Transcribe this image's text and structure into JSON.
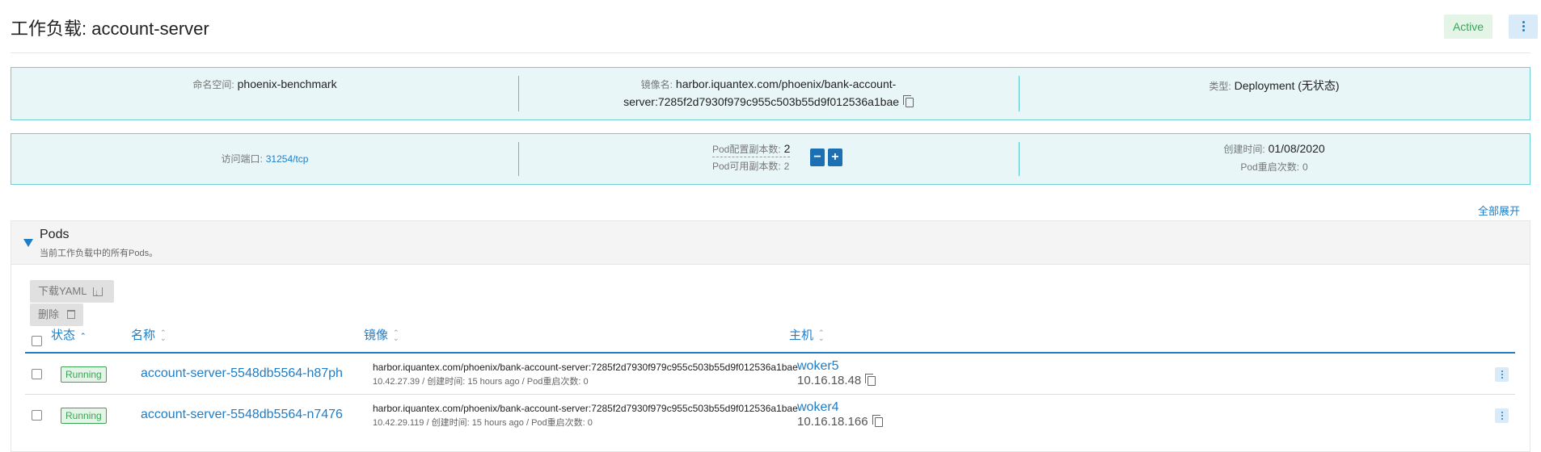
{
  "header": {
    "title": "工作负载: account-server",
    "status": "Active"
  },
  "info_top": {
    "namespace_label": "命名空间:",
    "namespace_value": "phoenix-benchmark",
    "image_label": "镜像名:",
    "image_value_line1": "harbor.iquantex.com/phoenix/bank-account-",
    "image_value_line2": "server:7285f2d7930f979c955c503b55d9f012536a1bae",
    "type_label": "类型:",
    "type_value": "Deployment (无状态)"
  },
  "info_bottom": {
    "port_label": "访问端口:",
    "port_value": "31254/tcp",
    "pod_config_label": "Pod配置副本数:",
    "pod_config_value": "2",
    "pod_available_label": "Pod可用副本数:",
    "pod_available_value": "2",
    "minus": "−",
    "plus": "+",
    "created_label": "创建时间:",
    "created_value": "01/08/2020",
    "restart_label": "Pod重启次数:",
    "restart_value": "0"
  },
  "expand_all": "全部展开",
  "pods": {
    "title": "Pods",
    "subtitle": "当前工作负载中的所有Pods。",
    "download_yaml": "下载YAML",
    "delete": "删除",
    "columns": [
      "状态",
      "名称",
      "镜像",
      "主机"
    ],
    "rows": [
      {
        "status": "Running",
        "name": "account-server-5548db5564-h87ph",
        "image": "harbor.iquantex.com/phoenix/bank-account-server:7285f2d7930f979c955c503b55d9f012536a1bae",
        "meta": "10.42.27.39  /  创建时间: 15 hours ago  /  Pod重启次数: 0",
        "host": "woker5",
        "host_ip": "10.16.18.48"
      },
      {
        "status": "Running",
        "name": "account-server-5548db5564-n7476",
        "image": "harbor.iquantex.com/phoenix/bank-account-server:7285f2d7930f979c955c503b55d9f012536a1bae",
        "meta": "10.42.29.119  /  创建时间: 15 hours ago  /  Pod重启次数: 0",
        "host": "woker4",
        "host_ip": "10.16.18.166"
      }
    ]
  }
}
